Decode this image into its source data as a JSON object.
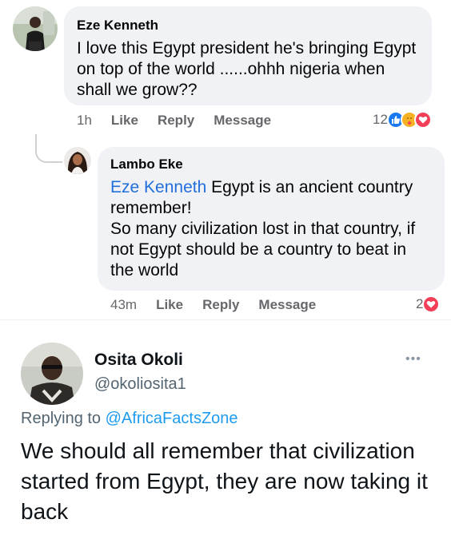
{
  "facebook": {
    "comment1": {
      "author": "Eze Kenneth",
      "text": "I love this Egypt president he's bringing Egypt on top of the world ......ohhh nigeria when shall we grow??",
      "time": "1h",
      "like_label": "Like",
      "reply_label": "Reply",
      "message_label": "Message",
      "reaction_count": "12",
      "reactions": [
        "like-icon",
        "care-icon",
        "love-icon"
      ]
    },
    "reply1": {
      "author": "Lambo Eke",
      "mention": "Eze Kenneth",
      "text_after_mention": " Egypt is an ancient country remember!",
      "text_line2": "So many civilization lost in that country, if not Egypt should be a country to beat in the world",
      "time": "43m",
      "like_label": "Like",
      "reply_label": "Reply",
      "message_label": "Message",
      "reaction_count": "2",
      "reactions": [
        "love-icon"
      ]
    }
  },
  "twitter": {
    "display_name": "Osita Okoli",
    "handle": "@okoliosita1",
    "more_label": "•••",
    "replying_prefix": "Replying to ",
    "replying_to": "@AfricaFactsZone",
    "tweet_text": "We should all remember that civilization started from Egypt, they are now taking it back"
  },
  "colors": {
    "bubble": "#f0f2f5",
    "mention": "#216fdb",
    "meta_text": "#65676b",
    "twitter_link": "#1d9bf0",
    "like_blue": "#1877f2",
    "love_red": "#f33e58",
    "care_yellow": "#f7b125"
  }
}
